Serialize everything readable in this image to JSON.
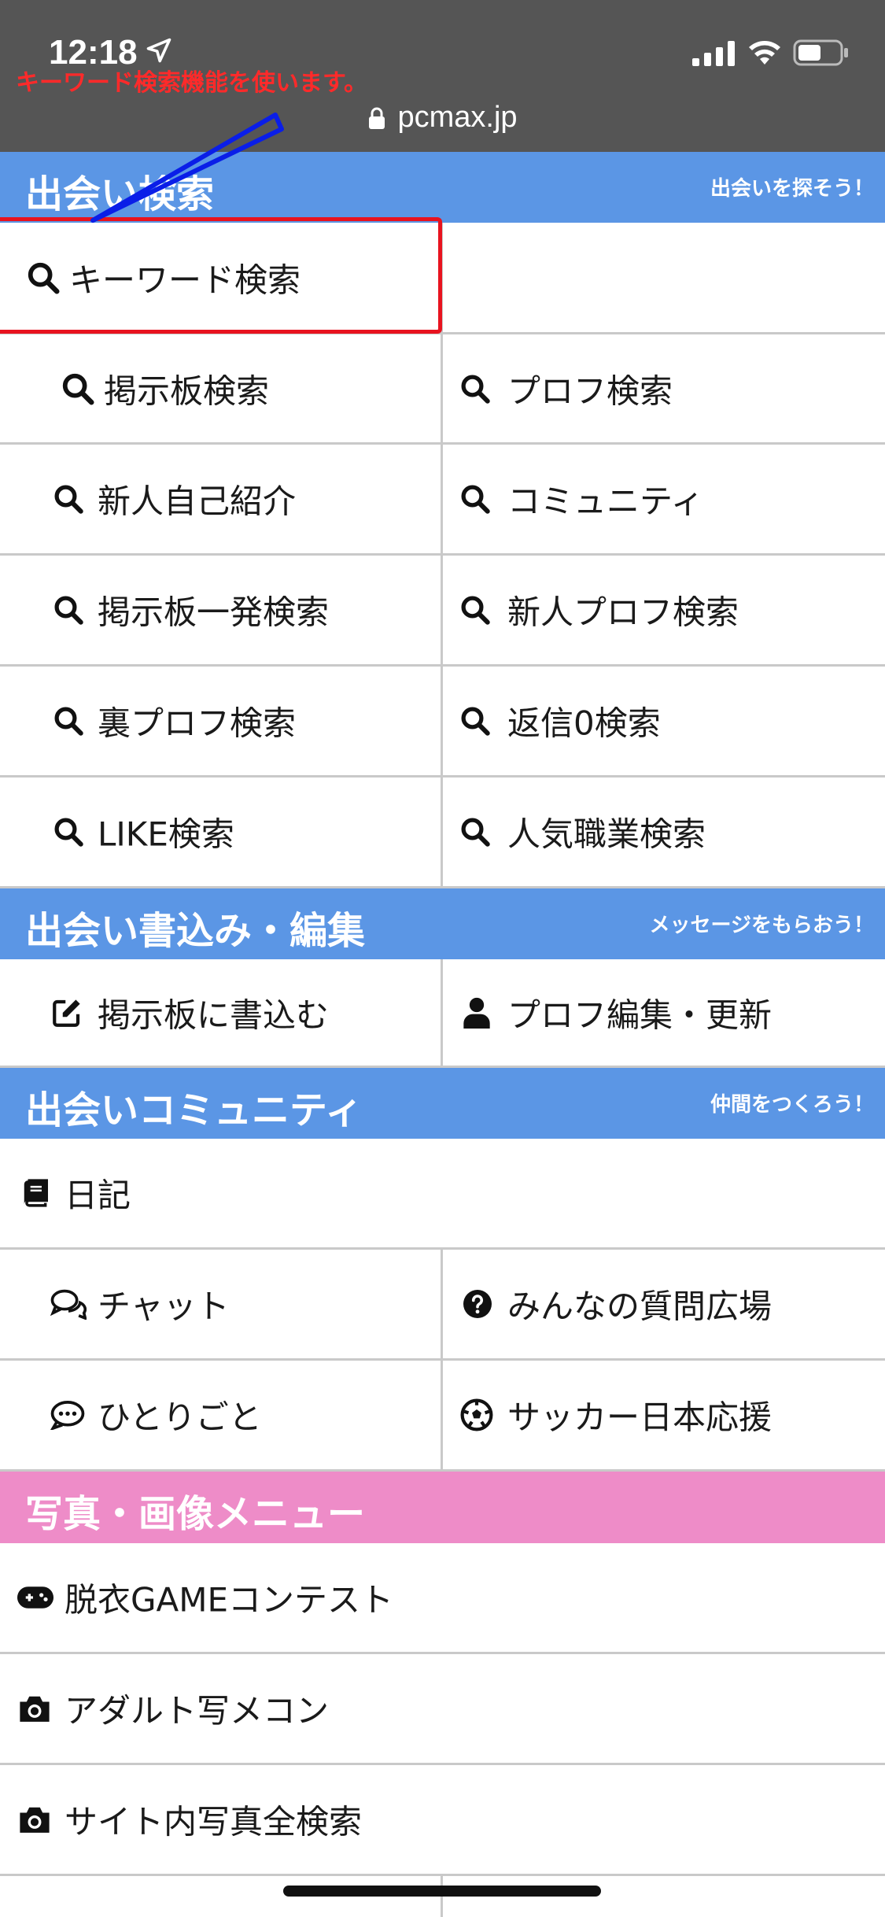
{
  "status_bar": {
    "time": "12:18",
    "url": "pcmax.jp"
  },
  "annotation": {
    "text": "キーワード検索機能を使います。",
    "color": "#ff2a2a"
  },
  "colors": {
    "section_blue": "#5b96e5",
    "section_pink": "#ee8cc8",
    "status_bg": "#555555"
  },
  "sections": {
    "search": {
      "title": "出会い検索",
      "subtitle": "出会いを探そう！"
    },
    "post": {
      "title": "出会い書込み・編集",
      "subtitle": "メッセージをもらおう！"
    },
    "community": {
      "title": "出会いコミュニティ",
      "subtitle": "仲間をつくろう！"
    },
    "photo": {
      "title": "写真・画像メニュー"
    }
  },
  "search_items": {
    "keyword": "キーワード検索",
    "bbs": "掲示板検索",
    "profile": "プロフ検索",
    "newcomer_intro": "新人自己紹介",
    "community": "コミュニティ",
    "bbs_quick": "掲示板一発検索",
    "new_profile": "新人プロフ検索",
    "secret_profile": "裏プロフ検索",
    "reply_zero": "返信0検索",
    "like": "LIKE検索",
    "popular_job": "人気職業検索"
  },
  "post_items": {
    "bbs_write": "掲示板に書込む",
    "profile_edit": "プロフ編集・更新"
  },
  "community_items": {
    "diary": "日記",
    "chat": "チャット",
    "qa": "みんなの質問広場",
    "monologue": "ひとりごと",
    "soccer": "サッカー日本応援"
  },
  "photo_items": {
    "contest": "脱衣GAMEコンテスト",
    "adult_photo": "アダルト写メコン",
    "site_photo": "サイト内写真全検索"
  },
  "icons": [
    "search-icon",
    "edit-icon",
    "user-icon",
    "book-icon",
    "chat-icon",
    "question-icon",
    "comment-icon",
    "soccer-ball-icon",
    "gamepad-icon",
    "camera-icon",
    "lock-icon"
  ]
}
